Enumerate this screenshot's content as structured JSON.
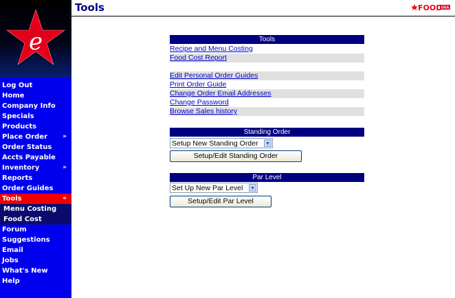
{
  "colors": {
    "sidebar_bg": "#0000ee",
    "active_item_bg": "#ee0000",
    "sub_item_bg": "#0b0b6e",
    "section_header_bg": "#000080",
    "link_color": "#0000cc",
    "shaded_row_bg": "#e0e0e0",
    "star_color": "#e3001b"
  },
  "header": {
    "title": "Tools",
    "brand_logo_text": "FOOD",
    "brand_logo_badge": "USA"
  },
  "sidebar": {
    "logo_letter": "e",
    "items": [
      {
        "label": "Log Out"
      },
      {
        "label": "Home"
      },
      {
        "label": "Company Info"
      },
      {
        "label": "Specials"
      },
      {
        "label": "Products"
      },
      {
        "label": "Place Order",
        "chevron": "»"
      },
      {
        "label": "Order Status"
      },
      {
        "label": "Accts Payable"
      },
      {
        "label": "Inventory",
        "chevron": "»"
      },
      {
        "label": "Reports"
      },
      {
        "label": "Order Guides"
      },
      {
        "label": "Tools",
        "chevron": "«",
        "active": true
      },
      {
        "label": "Menu Costing",
        "sub": true
      },
      {
        "label": "Food Cost",
        "sub": true
      },
      {
        "label": "Forum"
      },
      {
        "label": "Suggestions"
      },
      {
        "label": "Email"
      },
      {
        "label": "Jobs"
      },
      {
        "label": "What's New"
      },
      {
        "label": "Help"
      }
    ]
  },
  "tools": {
    "header": "Tools",
    "links": [
      "Recipe and Menu Costing",
      "Food Cost Report",
      "",
      "Edit Personal Order Guides",
      "Print Order Guide",
      "Change Order Email Addresses",
      "Change Password",
      "Browse Sales history"
    ]
  },
  "standing_order": {
    "header": "Standing Order",
    "select_value": "Setup New Standing Order",
    "button_label": "Setup/Edit Standing Order"
  },
  "par_level": {
    "header": "Par Level",
    "select_value": "Set Up New Par Level",
    "button_label": "Setup/Edit Par Level"
  }
}
